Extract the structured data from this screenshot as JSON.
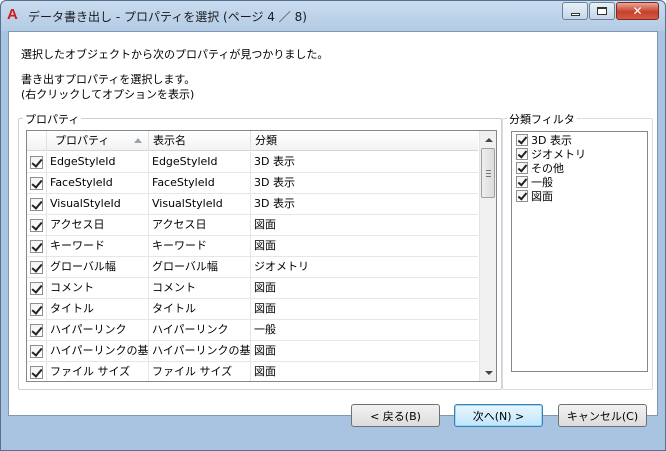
{
  "window": {
    "title": "データ書き出し - プロパティを選択 (ページ 4 ／ 8)",
    "app_logo": "A",
    "minimize_icon": "minimize-icon",
    "maximize_icon": "maximize-icon",
    "close_icon": "close-icon"
  },
  "messages": {
    "found": "選択したオブジェクトから次のプロパティが見つかりました。",
    "instruction": "書き出すプロパティを選択します。",
    "hint": "(右クリックしてオプションを表示)"
  },
  "properties_group": {
    "label": "プロパティ",
    "columns": [
      "プロパティ",
      "表示名",
      "分類"
    ],
    "rows": [
      {
        "checked": true,
        "property": "EdgeStyleId",
        "display": "EdgeStyleId",
        "category": "3D 表示"
      },
      {
        "checked": true,
        "property": "FaceStyleId",
        "display": "FaceStyleId",
        "category": "3D 表示"
      },
      {
        "checked": true,
        "property": "VisualStyleId",
        "display": "VisualStyleId",
        "category": "3D 表示"
      },
      {
        "checked": true,
        "property": "アクセス日",
        "display": "アクセス日",
        "category": "図面"
      },
      {
        "checked": true,
        "property": "キーワード",
        "display": "キーワード",
        "category": "図面"
      },
      {
        "checked": true,
        "property": "グローバル幅",
        "display": "グローバル幅",
        "category": "ジオメトリ"
      },
      {
        "checked": true,
        "property": "コメント",
        "display": "コメント",
        "category": "図面"
      },
      {
        "checked": true,
        "property": "タイトル",
        "display": "タイトル",
        "category": "図面"
      },
      {
        "checked": true,
        "property": "ハイパーリンク",
        "display": "ハイパーリンク",
        "category": "一般"
      },
      {
        "checked": true,
        "property": "ハイパーリンクの基...",
        "display": "ハイパーリンクの基...",
        "category": "図面"
      },
      {
        "checked": true,
        "property": "ファイル サイズ",
        "display": "ファイル サイズ",
        "category": "図面"
      }
    ]
  },
  "filter_group": {
    "label": "分類フィルタ",
    "items": [
      {
        "checked": true,
        "label": "3D 表示"
      },
      {
        "checked": true,
        "label": "ジオメトリ"
      },
      {
        "checked": true,
        "label": "その他"
      },
      {
        "checked": true,
        "label": "一般"
      },
      {
        "checked": true,
        "label": "図面"
      }
    ]
  },
  "buttons": {
    "back": "< 戻る(B)",
    "next": "次へ(N) >",
    "cancel": "キャンセル(C)"
  }
}
